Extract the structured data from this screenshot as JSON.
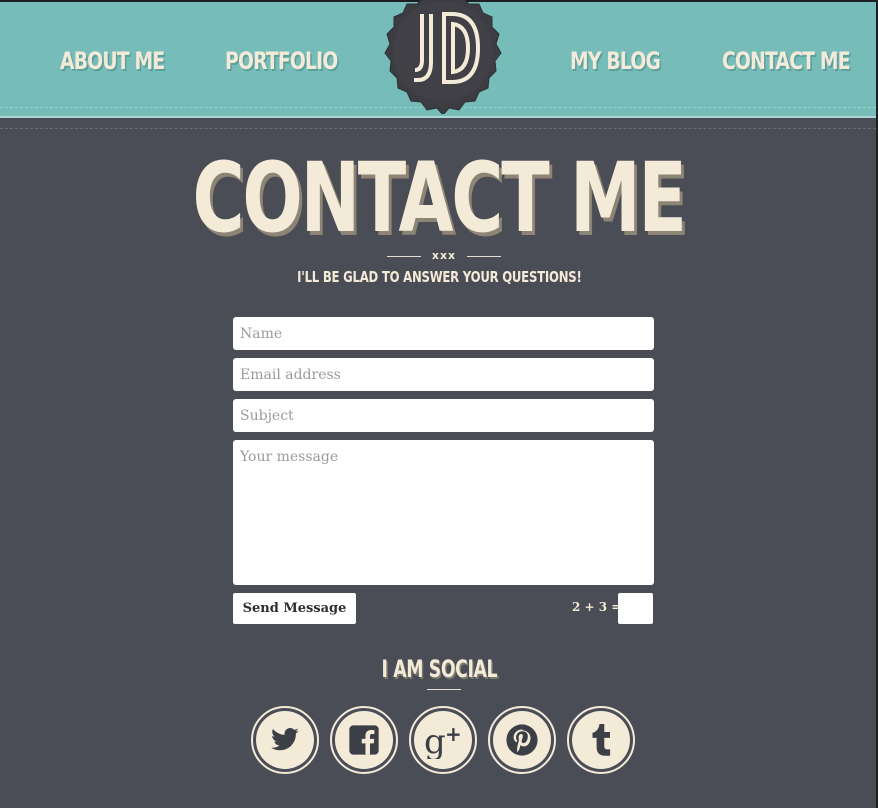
{
  "nav": {
    "about_label": "ABOUT ME",
    "portfolio_label": "PORTFOLIO",
    "blog_label": "MY BLOG",
    "contact_label": "CONTACT ME"
  },
  "logo": {
    "text": "JD"
  },
  "page": {
    "title": "CONTACT ME",
    "divider_text": "xxx",
    "subtitle": "I'LL BE GLAD TO ANSWER YOUR QUESTIONS!"
  },
  "form": {
    "name_placeholder": "Name",
    "email_placeholder": "Email address",
    "subject_placeholder": "Subject",
    "message_placeholder": "Your message",
    "send_label": "Send Message",
    "captcha_label": "2 + 3 =",
    "captcha_value": ""
  },
  "social": {
    "title": "I AM SOCIAL",
    "icons": [
      "twitter-icon",
      "facebook-icon",
      "google-plus-icon",
      "pinterest-icon",
      "tumblr-icon"
    ]
  },
  "colors": {
    "header": "#76bdba",
    "background": "#4b4d56",
    "cream": "#f3ead8"
  }
}
